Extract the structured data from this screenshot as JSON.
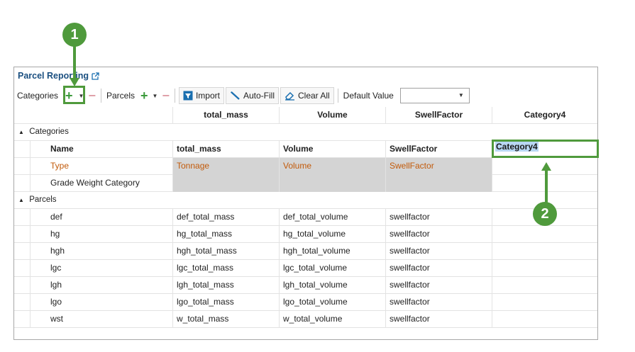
{
  "panel": {
    "title": "Parcel Reporting",
    "icons": {
      "external": "external-link-icon"
    }
  },
  "toolbar": {
    "categories_label": "Categories",
    "parcels_label": "Parcels",
    "import_label": "Import",
    "autofill_label": "Auto-Fill",
    "clearall_label": "Clear All",
    "default_value_label": "Default Value",
    "default_value": ""
  },
  "grid": {
    "columns": [
      "total_mass",
      "Volume",
      "SwellFactor",
      "Category4"
    ],
    "groups": {
      "categories": "Categories",
      "parcels": "Parcels"
    },
    "category_rows": [
      {
        "label": "Name",
        "c1": "total_mass",
        "c2": "Volume",
        "c3": "SwellFactor",
        "c4": "Category4"
      },
      {
        "label": "Type",
        "c1": "Tonnage",
        "c2": "Volume",
        "c3": "SwellFactor",
        "c4": ""
      },
      {
        "label": "Grade Weight Category",
        "c1": "",
        "c2": "",
        "c3": "",
        "c4": ""
      }
    ],
    "parcel_rows": [
      {
        "label": "def",
        "c1": "def_total_mass",
        "c2": "def_total_volume",
        "c3": "swellfactor"
      },
      {
        "label": "hg",
        "c1": "hg_total_mass",
        "c2": "hg_total_volume",
        "c3": "swellfactor"
      },
      {
        "label": "hgh",
        "c1": "hgh_total_mass",
        "c2": "hgh_total_volume",
        "c3": "swellfactor"
      },
      {
        "label": "lgc",
        "c1": "lgc_total_mass",
        "c2": "lgc_total_volume",
        "c3": "swellfactor"
      },
      {
        "label": "lgh",
        "c1": "lgh_total_mass",
        "c2": "lgh_total_volume",
        "c3": "swellfactor"
      },
      {
        "label": "lgo",
        "c1": "lgo_total_mass",
        "c2": "lgo_total_volume",
        "c3": "swellfactor"
      },
      {
        "label": "wst",
        "c1": "w_total_mass",
        "c2": "w_total_volume",
        "c3": "swellfactor"
      }
    ]
  },
  "callouts": [
    "1",
    "2"
  ],
  "colors": {
    "accent": "#4f9a3c",
    "title": "#1a4f80",
    "type_text": "#c25a0a"
  }
}
